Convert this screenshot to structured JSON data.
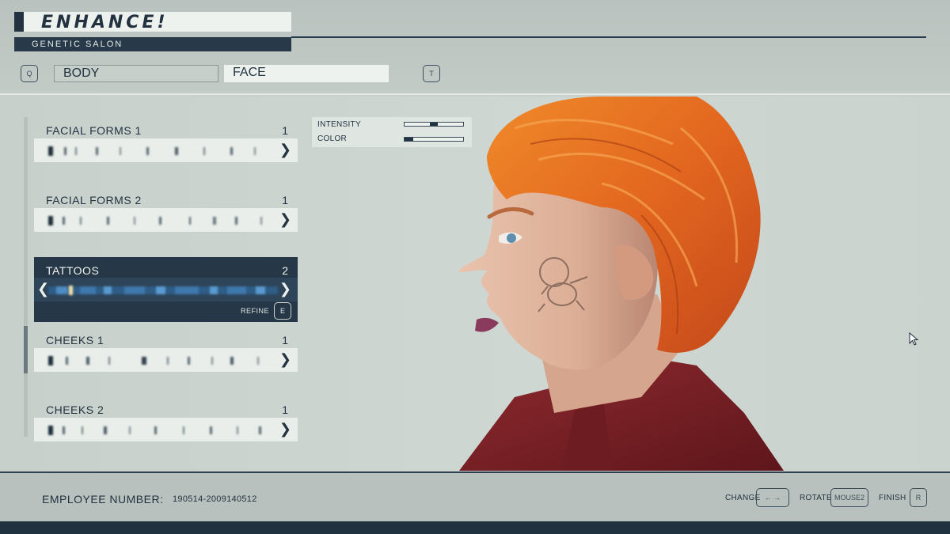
{
  "header": {
    "title": "ENHANCE!",
    "subtitle": "GENETIC SALON"
  },
  "tabs": {
    "prev_key": "Q",
    "next_key": "T",
    "items": [
      {
        "label": "BODY",
        "selected": false
      },
      {
        "label": "FACE",
        "selected": true
      }
    ]
  },
  "features": [
    {
      "label": "FACIAL FORMS 1",
      "value": "1",
      "selected": false
    },
    {
      "label": "FACIAL FORMS 2",
      "value": "1",
      "selected": false
    },
    {
      "label": "TATTOOS",
      "value": "2",
      "selected": true,
      "refine_label": "REFINE",
      "refine_key": "E"
    },
    {
      "label": "CHEEKS 1",
      "value": "1",
      "selected": false
    },
    {
      "label": "CHEEKS 2",
      "value": "1",
      "selected": false
    }
  ],
  "tone_panel": {
    "intensity_label": "INTENSITY",
    "intensity_level": 0.5,
    "color_label": "COLOR",
    "color_level": 0.15
  },
  "footer": {
    "employee_label": "EMPLOYEE NUMBER:",
    "employee_number": "190514-2009140512",
    "change_label": "CHANGE",
    "change_key": "← →",
    "rotate_label": "ROTATE",
    "rotate_key": "MOUSE2",
    "finish_label": "FINISH",
    "finish_key": "R"
  },
  "colors": {
    "accent_dark": "#223240",
    "selected_row": "#263747",
    "panel_light": "#e9eeea",
    "hair": "#e2661f",
    "jacket": "#7c1f25"
  }
}
